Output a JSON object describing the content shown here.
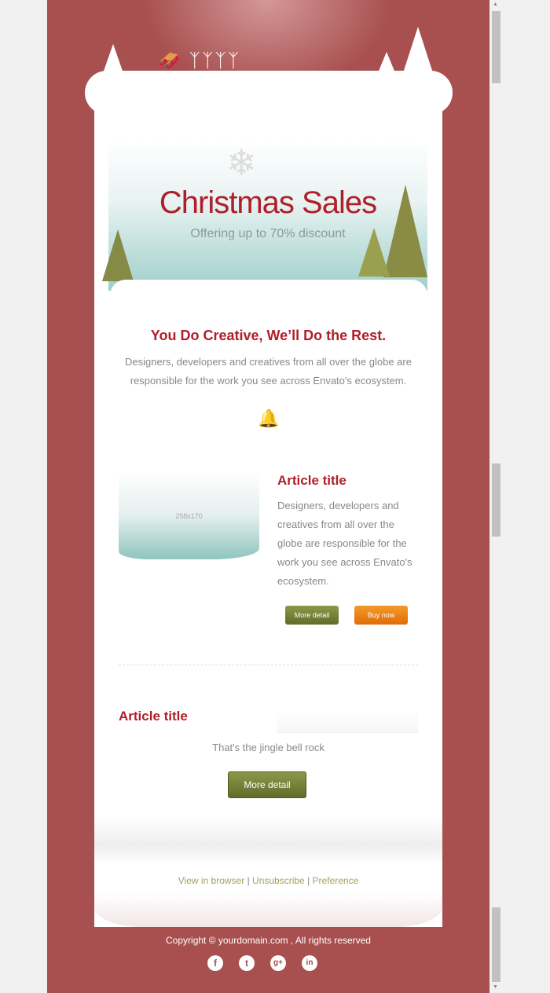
{
  "banner": {
    "title": "Christmas Sales",
    "subtitle": "Offering up to 70% discount"
  },
  "intro": {
    "heading": "You Do Creative, We’ll Do the Rest.",
    "text": "Designers, developers and creatives from all over the globe are responsible for the work you see across Envato's ecosystem."
  },
  "article1": {
    "image_label": "258x170",
    "title": "Article title",
    "text": "Designers, developers and creatives from all over the globe are responsible for the work you see across Envato's ecosystem.",
    "more_label": "More detail",
    "buy_label": "Buy now"
  },
  "article2": {
    "title": "Article title",
    "text": "That's the jingle bell rock",
    "more_label": "More detail"
  },
  "footer": {
    "links": [
      "View in browser",
      "Unsubscribe",
      "Preference"
    ],
    "separator": "|",
    "copyright": "Copyright © yourdomain.com , All rights reserved",
    "social": [
      {
        "icon": "facebook-icon",
        "glyph": "f"
      },
      {
        "icon": "twitter-icon",
        "glyph": "t"
      },
      {
        "icon": "google-plus-icon",
        "glyph": "g+"
      },
      {
        "icon": "linkedin-icon",
        "glyph": "in"
      }
    ]
  },
  "colors": {
    "background": "#a84f4f",
    "accent": "#b01e2a",
    "green_button": "#6f7d35",
    "orange_button": "#e97c12",
    "link": "#a6a060"
  }
}
